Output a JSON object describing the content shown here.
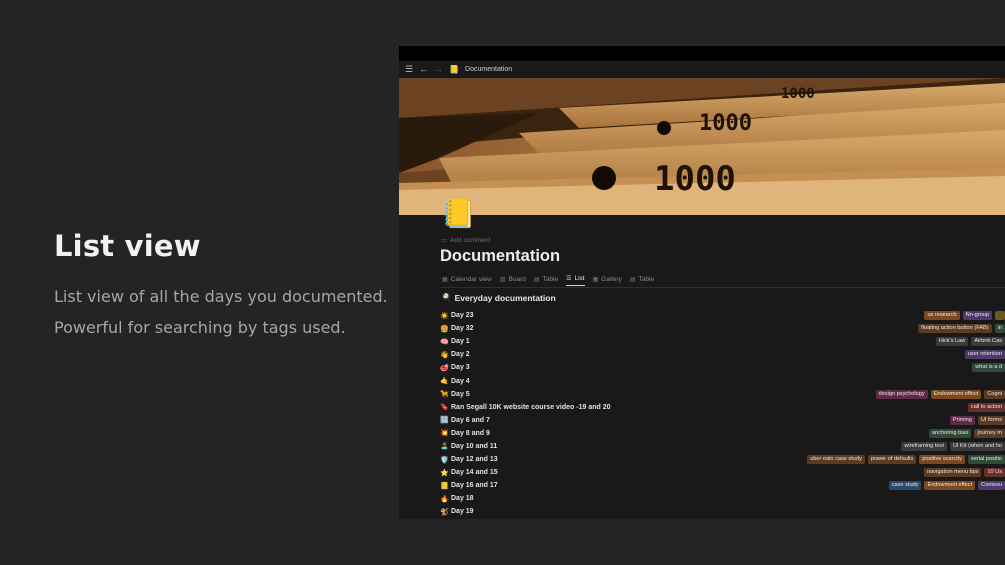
{
  "promo": {
    "title": "List view",
    "desc1": "List view of all the days you documented.",
    "desc2": "Powerful for searching by tags used."
  },
  "topbar": {
    "menu_icon": "menu-icon",
    "back_icon": "arrow-left-icon",
    "forward_icon": "arrow-right-icon",
    "page_emoji": "📒",
    "breadcrumb": "Documentation"
  },
  "page": {
    "icon": "📒",
    "add_comment": "Add comment",
    "title": "Documentation"
  },
  "tabs": [
    {
      "label": "Calendar view",
      "icon": "▦"
    },
    {
      "label": "Board",
      "icon": "▥"
    },
    {
      "label": "Table",
      "icon": "▤"
    },
    {
      "label": "List",
      "icon": "☰"
    },
    {
      "label": "Gallery",
      "icon": "▦"
    },
    {
      "label": "Table",
      "icon": "▤"
    }
  ],
  "database": {
    "emoji": "🍳",
    "title": "Everyday documentation"
  },
  "rows": [
    {
      "emoji": "☀️",
      "name": "Day 23",
      "tags": [
        {
          "t": "ux research",
          "c": "t-orange"
        },
        {
          "t": "Nn-group",
          "c": "t-purple"
        },
        {
          "t": "",
          "c": "t-yellow"
        }
      ]
    },
    {
      "emoji": "🍔",
      "name": "Day 32",
      "tags": [
        {
          "t": "floating action button (FAB)",
          "c": "t-brown"
        },
        {
          "t": "in",
          "c": "t-green"
        }
      ]
    },
    {
      "emoji": "🧠",
      "name": "Day 1",
      "tags": [
        {
          "t": "Hick's Law",
          "c": "t-gray"
        },
        {
          "t": "Airbnb Cas",
          "c": "t-gray"
        }
      ]
    },
    {
      "emoji": "👋",
      "name": "Day 2",
      "tags": [
        {
          "t": "user retention",
          "c": "t-purple"
        }
      ]
    },
    {
      "emoji": "🥩",
      "name": "Day 3",
      "tags": [
        {
          "t": "what is a d",
          "c": "t-green"
        }
      ]
    },
    {
      "emoji": "🤙",
      "name": "Day 4",
      "tags": []
    },
    {
      "emoji": "🦮",
      "name": "Day 5",
      "tags": [
        {
          "t": "design psychology",
          "c": "t-pink"
        },
        {
          "t": "Endowment effect",
          "c": "t-orange"
        },
        {
          "t": "Cogni",
          "c": "t-brown"
        }
      ]
    },
    {
      "emoji": "🔖",
      "name": "Ran Segall 10K website course video -19 and 20",
      "tags": [
        {
          "t": "call to action",
          "c": "t-red"
        }
      ]
    },
    {
      "emoji": "🔢",
      "name": "Day 6 and 7",
      "tags": [
        {
          "t": "Priming",
          "c": "t-pink"
        },
        {
          "t": "UI forms",
          "c": "t-brown"
        }
      ]
    },
    {
      "emoji": "💥",
      "name": "Day 8 and 9",
      "tags": [
        {
          "t": "anchoring bias",
          "c": "t-green"
        },
        {
          "t": "journey m",
          "c": "t-brown"
        }
      ]
    },
    {
      "emoji": "🏝️",
      "name": "Day 10 and 11",
      "tags": [
        {
          "t": "wireframing tool",
          "c": "t-gray"
        },
        {
          "t": "UI Kit (when and ho",
          "c": "t-gray"
        }
      ]
    },
    {
      "emoji": "🛡️",
      "name": "Day 12 and 13",
      "tags": [
        {
          "t": "uber eats case study",
          "c": "t-brown"
        },
        {
          "t": "power of defaults",
          "c": "t-brown"
        },
        {
          "t": "positive scarcity",
          "c": "t-orange"
        },
        {
          "t": "serial positio",
          "c": "t-green"
        }
      ]
    },
    {
      "emoji": "⭐",
      "name": "Day 14 and 15",
      "tags": [
        {
          "t": "navigation menu tips",
          "c": "t-brown"
        },
        {
          "t": "10 Us",
          "c": "t-red"
        }
      ]
    },
    {
      "emoji": "📒",
      "name": "Day 16 and 17",
      "tags": [
        {
          "t": "case study",
          "c": "t-blue"
        },
        {
          "t": "Endowment effect",
          "c": "t-orange"
        },
        {
          "t": "Contexu",
          "c": "t-purple"
        }
      ]
    },
    {
      "emoji": "🔥",
      "name": "Day 18",
      "tags": []
    },
    {
      "emoji": "🐒",
      "name": "Day 19",
      "tags": []
    }
  ]
}
